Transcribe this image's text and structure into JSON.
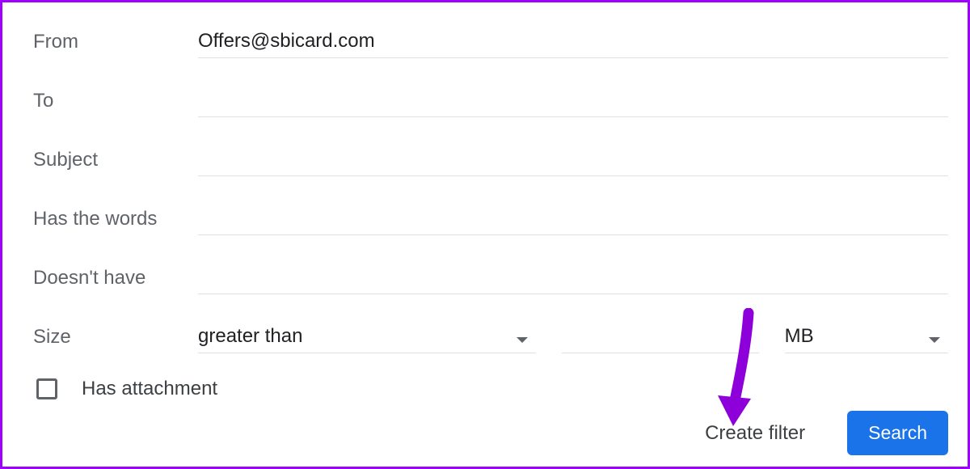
{
  "fields": {
    "from_label": "From",
    "from_value": "Offers@sbicard.com",
    "to_label": "To",
    "to_value": "",
    "subject_label": "Subject",
    "subject_value": "",
    "haswords_label": "Has the words",
    "haswords_value": "",
    "nothave_label": "Doesn't have",
    "nothave_value": "",
    "size_label": "Size",
    "size_comparator": "greater than",
    "size_value": "",
    "size_unit": "MB",
    "has_attachment_label": "Has attachment",
    "has_attachment_checked": false
  },
  "actions": {
    "create_filter": "Create filter",
    "search": "Search"
  },
  "annotation": {
    "arrow_color": "#8e00d9"
  }
}
